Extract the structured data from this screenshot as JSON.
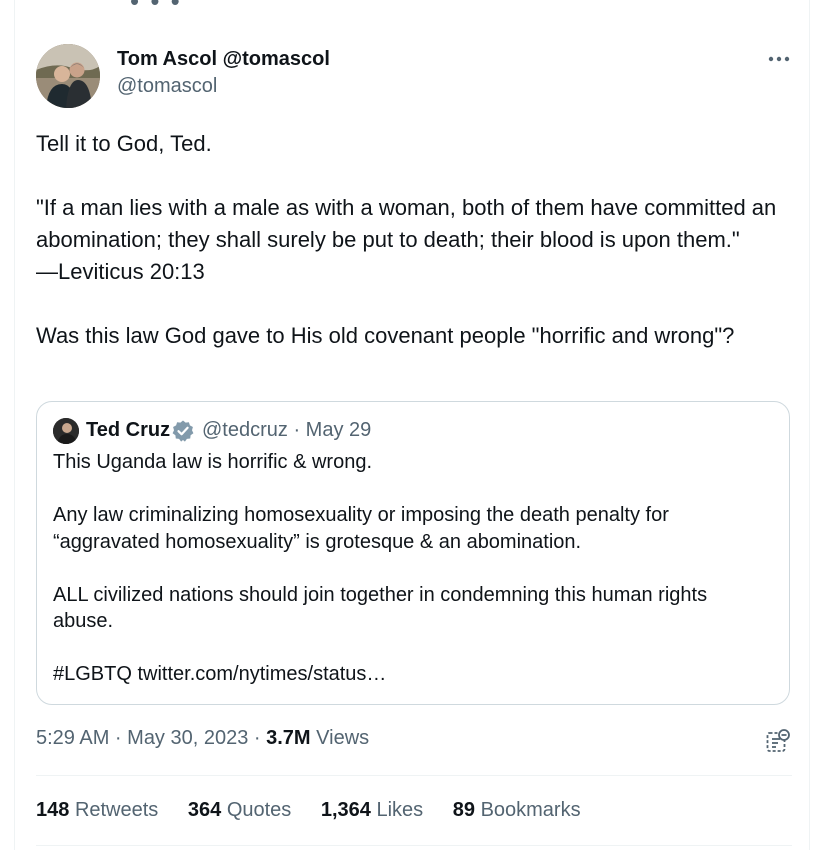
{
  "tweet": {
    "author": {
      "display": "Tom Ascol @tomascol",
      "handle": "@tomascol"
    },
    "paragraphs": [
      "Tell it to God, Ted.",
      "\"If a man lies with a male as with a woman, both of them have committed an abomination; they shall surely be put to death; their blood is upon them.\"\n—Leviticus 20:13",
      "Was this law God gave to His old covenant people \"horrific and wrong\"?"
    ],
    "quote": {
      "name": "Ted Cruz",
      "handle_date": "@tedcruz · May 29",
      "paragraphs": [
        "This Uganda law is horrific & wrong.",
        "Any law criminalizing homosexuality or imposing the death penalty for\n“aggravated homosexuality” is grotesque & an abomination.",
        "ALL civilized nations should join together in condemning this human rights\nabuse.",
        "#LGBTQ twitter.com/nytimes/status…"
      ]
    },
    "meta": {
      "timestamp": "5:29 AM · May 30, 2023 · ",
      "views_count": "3.7M",
      "views_label": " Views"
    },
    "stats": {
      "retweets": {
        "count": "148",
        "label": "Retweets"
      },
      "quotes": {
        "count": "364",
        "label": "Quotes"
      },
      "likes": {
        "count": "1,364",
        "label": "Likes"
      },
      "bookmarks": {
        "count": "89",
        "label": "Bookmarks"
      }
    }
  },
  "icons": {
    "more": "more-horizontal-icon",
    "verified": "verified-badge-icon",
    "analytics": "analytics-icon"
  },
  "colors": {
    "text": "#0f1419",
    "secondary": "#536471",
    "border": "#cfd9de",
    "verified": "#829aab"
  }
}
